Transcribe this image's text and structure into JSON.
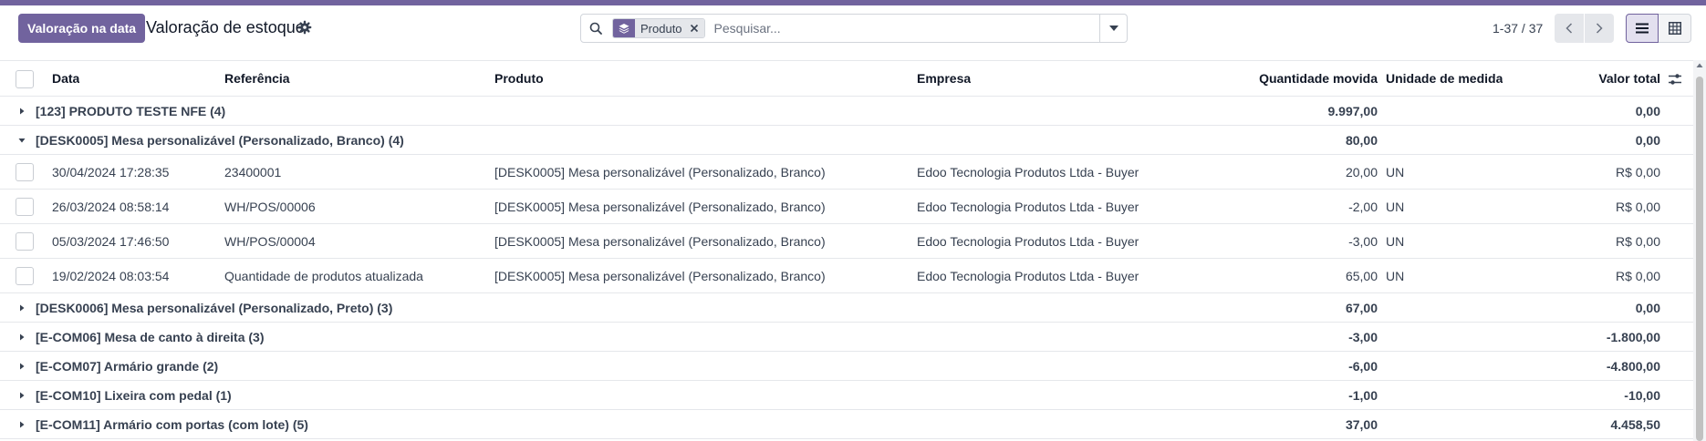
{
  "toolbar": {
    "primary_button": "Valoração na data",
    "title": "Valoração de estoque"
  },
  "search": {
    "facet_label": "Produto",
    "placeholder": "Pesquisar..."
  },
  "pager": {
    "value": "1-37 / 37"
  },
  "table": {
    "columns": {
      "date": "Data",
      "reference": "Referência",
      "product": "Produto",
      "company": "Empresa",
      "quantity": "Quantidade movida",
      "uom": "Unidade de medida",
      "total": "Valor total"
    },
    "rows": [
      {
        "name": "[123] PRODUTO TESTE NFE (4)",
        "qty": "9.997,00",
        "total": "0,00"
      },
      {
        "name": "[DESK0005] Mesa personalizável (Personalizado, Branco) (4)",
        "qty": "80,00",
        "total": "0,00"
      },
      {
        "date": "30/04/2024 17:28:35",
        "reference": "23400001",
        "product": "[DESK0005] Mesa personalizável (Personalizado, Branco)",
        "company": "Edoo Tecnologia Produtos Ltda - Buyer",
        "qty": "20,00",
        "uom": "UN",
        "total": "R$ 0,00"
      },
      {
        "date": "26/03/2024 08:58:14",
        "reference": "WH/POS/00006",
        "product": "[DESK0005] Mesa personalizável (Personalizado, Branco)",
        "company": "Edoo Tecnologia Produtos Ltda - Buyer",
        "qty": "-2,00",
        "uom": "UN",
        "total": "R$ 0,00"
      },
      {
        "date": "05/03/2024 17:46:50",
        "reference": "WH/POS/00004",
        "product": "[DESK0005] Mesa personalizável (Personalizado, Branco)",
        "company": "Edoo Tecnologia Produtos Ltda - Buyer",
        "qty": "-3,00",
        "uom": "UN",
        "total": "R$ 0,00"
      },
      {
        "date": "19/02/2024 08:03:54",
        "reference": "Quantidade de produtos atualizada",
        "product": "[DESK0005] Mesa personalizável (Personalizado, Branco)",
        "company": "Edoo Tecnologia Produtos Ltda - Buyer",
        "qty": "65,00",
        "uom": "UN",
        "total": "R$ 0,00"
      },
      {
        "name": "[DESK0006] Mesa personalizável (Personalizado, Preto) (3)",
        "qty": "67,00",
        "total": "0,00"
      },
      {
        "name": "[E-COM06] Mesa de canto à direita (3)",
        "qty": "-3,00",
        "total": "-1.800,00"
      },
      {
        "name": "[E-COM07] Armário grande (2)",
        "qty": "-6,00",
        "total": "-4.800,00"
      },
      {
        "name": "[E-COM10] Lixeira com pedal (1)",
        "qty": "-1,00",
        "total": "-10,00"
      },
      {
        "name": "[E-COM11] Armário com portas (com lote) (5)",
        "qty": "37,00",
        "total": "4.458,50"
      }
    ]
  },
  "colors": {
    "brand": "#71639e"
  }
}
